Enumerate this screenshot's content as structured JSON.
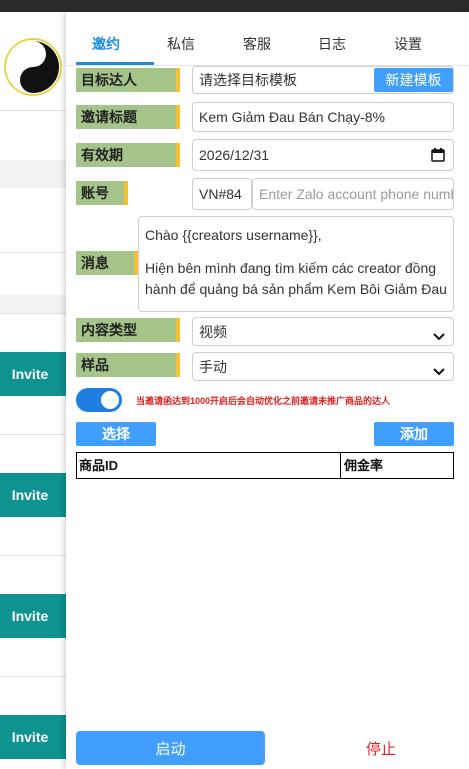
{
  "background": {
    "invite_buttons": [
      "Invite",
      "Invite",
      "Invite",
      "Invite"
    ],
    "accent_color": "#0e9390"
  },
  "tabs": [
    {
      "label": "邀约",
      "active": true
    },
    {
      "label": "私信",
      "active": false
    },
    {
      "label": "客服",
      "active": false
    },
    {
      "label": "日志",
      "active": false
    },
    {
      "label": "设置",
      "active": false
    }
  ],
  "form": {
    "target": {
      "label": "目标达人",
      "placeholder": "请选择目标模板",
      "button": "新建模板"
    },
    "title": {
      "label": "邀请标题",
      "value": "Kem Giảm Đau Bán Chạy-8%"
    },
    "expiry": {
      "label": "有效期",
      "value": "2026/12/31"
    },
    "account": {
      "label": "账号",
      "prefix": "VN#84",
      "placeholder": "Enter Zalo account phone number"
    },
    "message": {
      "label": "消息",
      "line1": "Chào {{creators username}},",
      "line2": "Hiện bên mình đang tìm kiếm các creator đồng hành để quảng bá sản phẩm Kem Bôi Giảm Đau"
    },
    "content_type": {
      "label": "内容类型",
      "value": "视频"
    },
    "sample": {
      "label": "样品",
      "value": "手动"
    }
  },
  "toggle": {
    "on": true,
    "hint": "当邀请函达到1000开启后会自动优化之前邀请未推广商品的达人"
  },
  "actions": {
    "select": "选择",
    "add": "添加"
  },
  "table": {
    "headers": [
      "商品ID",
      "佣金率"
    ]
  },
  "footer": {
    "start": "启动",
    "stop": "停止"
  },
  "colors": {
    "tab_active": "#1e8ee0",
    "button": "#409eff",
    "label_bg": "#a5c48a",
    "label_accent": "#f4c035",
    "danger": "#e02020"
  }
}
